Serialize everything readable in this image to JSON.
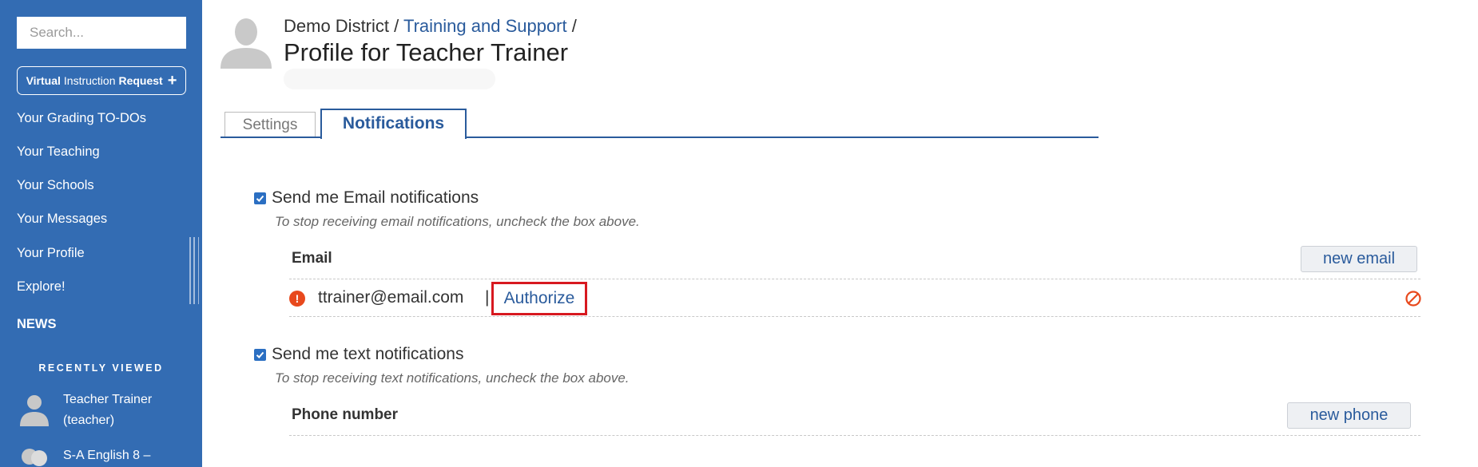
{
  "sidebar": {
    "search_placeholder": "Search...",
    "vir_button": {
      "bold1": "Virtual",
      "normal": "Instruction",
      "bold2": "Request",
      "plus": "+"
    },
    "nav_items": [
      "Your Grading TO-DOs",
      "Your Teaching",
      "Your Schools",
      "Your Messages",
      "Your Profile",
      "Explore!"
    ],
    "news_label": "NEWS",
    "recent_heading": "RECENTLY VIEWED",
    "recent_items": [
      {
        "label": "Teacher Trainer (teacher)"
      },
      {
        "label": "S-A English 8 –"
      }
    ]
  },
  "header": {
    "crumb_district": "Demo District",
    "crumb_sep": " / ",
    "crumb_training": "Training and Support",
    "crumb_trail": " /",
    "title": "Profile for Teacher Trainer"
  },
  "tabs": [
    {
      "label": "Settings",
      "active": false
    },
    {
      "label": "Notifications",
      "active": true
    }
  ],
  "email_section": {
    "checkbox_label": "Send me Email notifications",
    "checked": true,
    "help_text": "To stop receiving email notifications, uncheck the box above.",
    "column_label": "Email",
    "new_button": "new email",
    "entry": {
      "status_icon": "warning-icon",
      "address": "ttrainer@email.com",
      "separator": "|",
      "action": "Authorize"
    }
  },
  "text_section": {
    "checkbox_label": "Send me text notifications",
    "checked": true,
    "help_text": "To stop receiving text notifications, uncheck the box above.",
    "column_label": "Phone number",
    "new_button": "new phone"
  },
  "colors": {
    "sidebar": "#336cb3",
    "link": "#2a5b9c",
    "warning": "#e8491d",
    "highlight": "#d71920"
  }
}
